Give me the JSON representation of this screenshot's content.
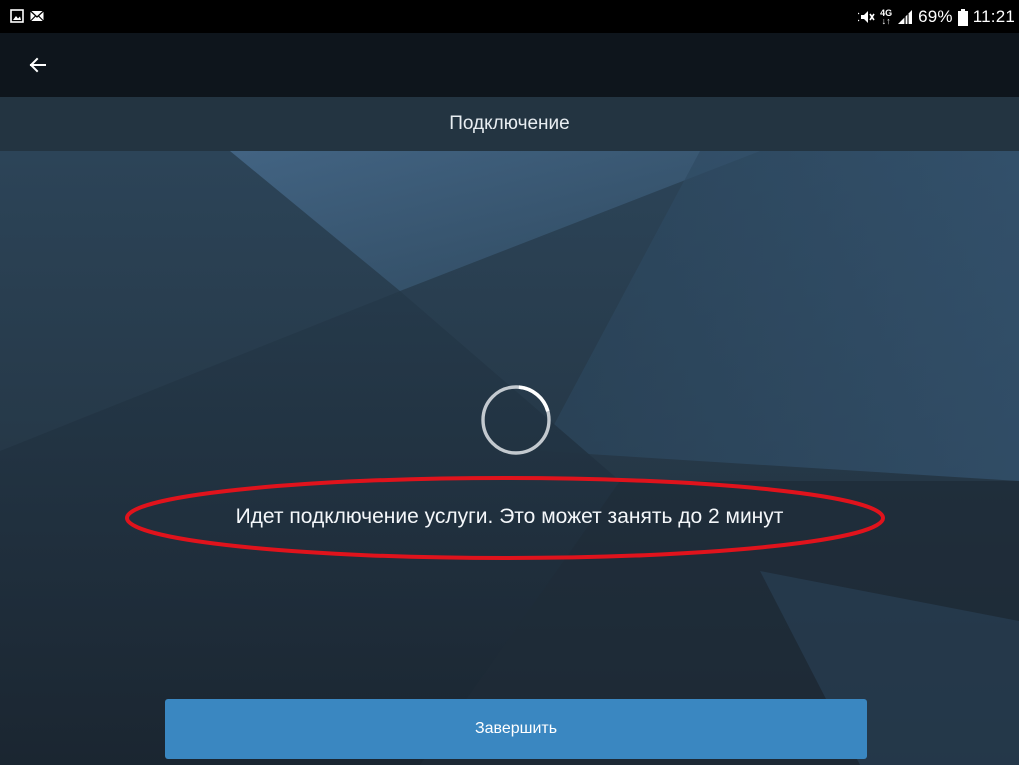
{
  "status_bar": {
    "battery": "69%",
    "time": "11:21",
    "network": "4G",
    "left_icons": [
      "gallery-icon",
      "mail-icon"
    ],
    "right_icons": [
      "mute-icon",
      "data-arrows-icon",
      "signal-icon",
      "battery-icon"
    ]
  },
  "toolbar": {
    "back_icon": "arrow-left-icon"
  },
  "header": {
    "title": "Подключение"
  },
  "content": {
    "message": "Идет подключение услуги. Это может занять до 2 минут",
    "loading_icon": "spinner-icon",
    "annotation_color": "#e0131c"
  },
  "actions": {
    "finish_label": "Завершить"
  },
  "colors": {
    "toolbar_bg": "#0e151c",
    "header_bg": "#233441",
    "button_bg": "#3a87c1"
  }
}
